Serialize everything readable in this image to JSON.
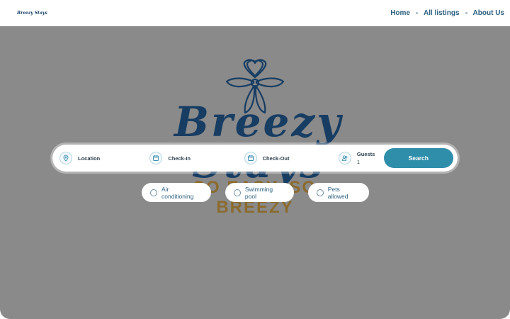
{
  "brand": {
    "logo_text": "Breezy Stays"
  },
  "nav": {
    "links": [
      "Home",
      "All listings",
      "About Us"
    ]
  },
  "hero": {
    "logo_text": "Breezy Stays",
    "tagline": "SO EASY, SO BREEZY"
  },
  "search": {
    "location_label": "Location",
    "checkin_label": "Check-In",
    "checkout_label": "Check-Out",
    "guests_label": "Guests",
    "guests_value": "1",
    "button_label": "Search"
  },
  "filters": [
    "Air conditioning",
    "Swimming pool",
    "Pets allowed"
  ],
  "colors": {
    "accent": "#2f8eaa",
    "brand": "#173d63",
    "nav_text": "#2c5f7f",
    "hero_overlay": "#8a8a8a"
  },
  "icons": {
    "location": "map-pin-icon",
    "checkin": "calendar-icon",
    "checkout": "calendar-icon",
    "guests": "users-icon"
  }
}
